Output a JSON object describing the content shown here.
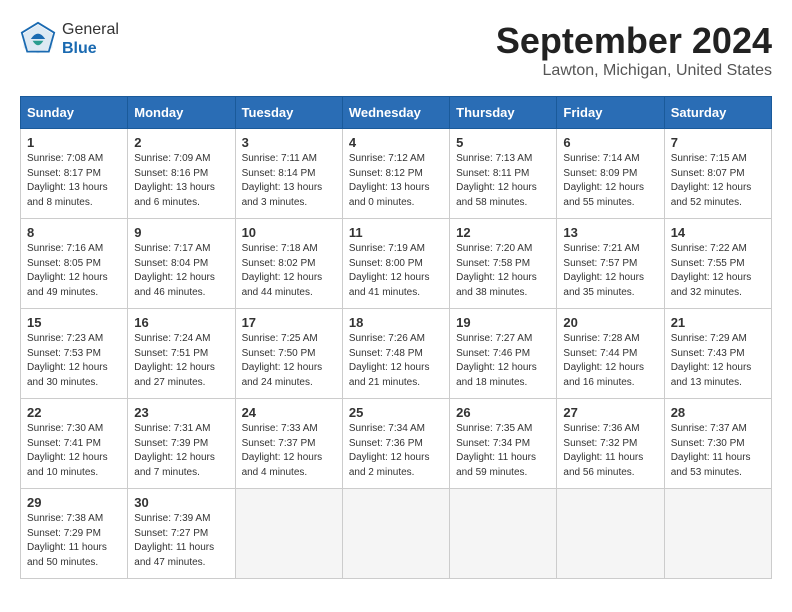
{
  "header": {
    "logo_general": "General",
    "logo_blue": "Blue",
    "title": "September 2024",
    "subtitle": "Lawton, Michigan, United States"
  },
  "weekdays": [
    "Sunday",
    "Monday",
    "Tuesday",
    "Wednesday",
    "Thursday",
    "Friday",
    "Saturday"
  ],
  "weeks": [
    [
      {
        "day": 1,
        "sunrise": "7:08 AM",
        "sunset": "8:17 PM",
        "daylight": "13 hours and 8 minutes."
      },
      {
        "day": 2,
        "sunrise": "7:09 AM",
        "sunset": "8:16 PM",
        "daylight": "13 hours and 6 minutes."
      },
      {
        "day": 3,
        "sunrise": "7:11 AM",
        "sunset": "8:14 PM",
        "daylight": "13 hours and 3 minutes."
      },
      {
        "day": 4,
        "sunrise": "7:12 AM",
        "sunset": "8:12 PM",
        "daylight": "13 hours and 0 minutes."
      },
      {
        "day": 5,
        "sunrise": "7:13 AM",
        "sunset": "8:11 PM",
        "daylight": "12 hours and 58 minutes."
      },
      {
        "day": 6,
        "sunrise": "7:14 AM",
        "sunset": "8:09 PM",
        "daylight": "12 hours and 55 minutes."
      },
      {
        "day": 7,
        "sunrise": "7:15 AM",
        "sunset": "8:07 PM",
        "daylight": "12 hours and 52 minutes."
      }
    ],
    [
      {
        "day": 8,
        "sunrise": "7:16 AM",
        "sunset": "8:05 PM",
        "daylight": "12 hours and 49 minutes."
      },
      {
        "day": 9,
        "sunrise": "7:17 AM",
        "sunset": "8:04 PM",
        "daylight": "12 hours and 46 minutes."
      },
      {
        "day": 10,
        "sunrise": "7:18 AM",
        "sunset": "8:02 PM",
        "daylight": "12 hours and 44 minutes."
      },
      {
        "day": 11,
        "sunrise": "7:19 AM",
        "sunset": "8:00 PM",
        "daylight": "12 hours and 41 minutes."
      },
      {
        "day": 12,
        "sunrise": "7:20 AM",
        "sunset": "7:58 PM",
        "daylight": "12 hours and 38 minutes."
      },
      {
        "day": 13,
        "sunrise": "7:21 AM",
        "sunset": "7:57 PM",
        "daylight": "12 hours and 35 minutes."
      },
      {
        "day": 14,
        "sunrise": "7:22 AM",
        "sunset": "7:55 PM",
        "daylight": "12 hours and 32 minutes."
      }
    ],
    [
      {
        "day": 15,
        "sunrise": "7:23 AM",
        "sunset": "7:53 PM",
        "daylight": "12 hours and 30 minutes."
      },
      {
        "day": 16,
        "sunrise": "7:24 AM",
        "sunset": "7:51 PM",
        "daylight": "12 hours and 27 minutes."
      },
      {
        "day": 17,
        "sunrise": "7:25 AM",
        "sunset": "7:50 PM",
        "daylight": "12 hours and 24 minutes."
      },
      {
        "day": 18,
        "sunrise": "7:26 AM",
        "sunset": "7:48 PM",
        "daylight": "12 hours and 21 minutes."
      },
      {
        "day": 19,
        "sunrise": "7:27 AM",
        "sunset": "7:46 PM",
        "daylight": "12 hours and 18 minutes."
      },
      {
        "day": 20,
        "sunrise": "7:28 AM",
        "sunset": "7:44 PM",
        "daylight": "12 hours and 16 minutes."
      },
      {
        "day": 21,
        "sunrise": "7:29 AM",
        "sunset": "7:43 PM",
        "daylight": "12 hours and 13 minutes."
      }
    ],
    [
      {
        "day": 22,
        "sunrise": "7:30 AM",
        "sunset": "7:41 PM",
        "daylight": "12 hours and 10 minutes."
      },
      {
        "day": 23,
        "sunrise": "7:31 AM",
        "sunset": "7:39 PM",
        "daylight": "12 hours and 7 minutes."
      },
      {
        "day": 24,
        "sunrise": "7:33 AM",
        "sunset": "7:37 PM",
        "daylight": "12 hours and 4 minutes."
      },
      {
        "day": 25,
        "sunrise": "7:34 AM",
        "sunset": "7:36 PM",
        "daylight": "12 hours and 2 minutes."
      },
      {
        "day": 26,
        "sunrise": "7:35 AM",
        "sunset": "7:34 PM",
        "daylight": "11 hours and 59 minutes."
      },
      {
        "day": 27,
        "sunrise": "7:36 AM",
        "sunset": "7:32 PM",
        "daylight": "11 hours and 56 minutes."
      },
      {
        "day": 28,
        "sunrise": "7:37 AM",
        "sunset": "7:30 PM",
        "daylight": "11 hours and 53 minutes."
      }
    ],
    [
      {
        "day": 29,
        "sunrise": "7:38 AM",
        "sunset": "7:29 PM",
        "daylight": "11 hours and 50 minutes."
      },
      {
        "day": 30,
        "sunrise": "7:39 AM",
        "sunset": "7:27 PM",
        "daylight": "11 hours and 47 minutes."
      },
      null,
      null,
      null,
      null,
      null
    ]
  ]
}
